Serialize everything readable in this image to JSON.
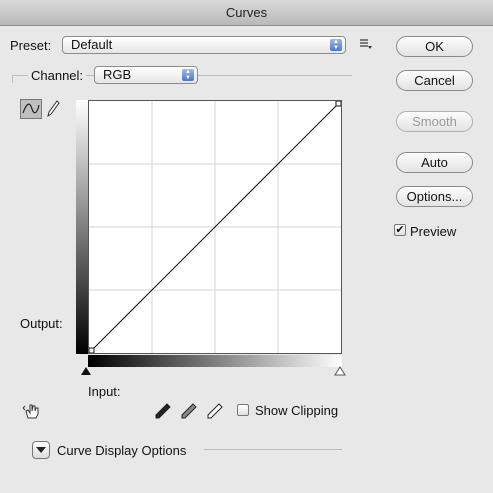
{
  "window": {
    "title": "Curves"
  },
  "preset": {
    "label": "Preset:",
    "value": "Default"
  },
  "channel": {
    "label": "Channel:",
    "value": "RGB"
  },
  "buttons": {
    "ok": "OK",
    "cancel": "Cancel",
    "smooth": "Smooth",
    "auto": "Auto",
    "options": "Options..."
  },
  "preview": {
    "label": "Preview",
    "checked": true
  },
  "graph": {
    "output_label": "Output:",
    "input_label": "Input:",
    "curve_points": [
      [
        0,
        0
      ],
      [
        255,
        255
      ]
    ]
  },
  "show_clipping": {
    "label": "Show Clipping",
    "checked": false
  },
  "curve_display_options": {
    "label": "Curve Display Options"
  }
}
